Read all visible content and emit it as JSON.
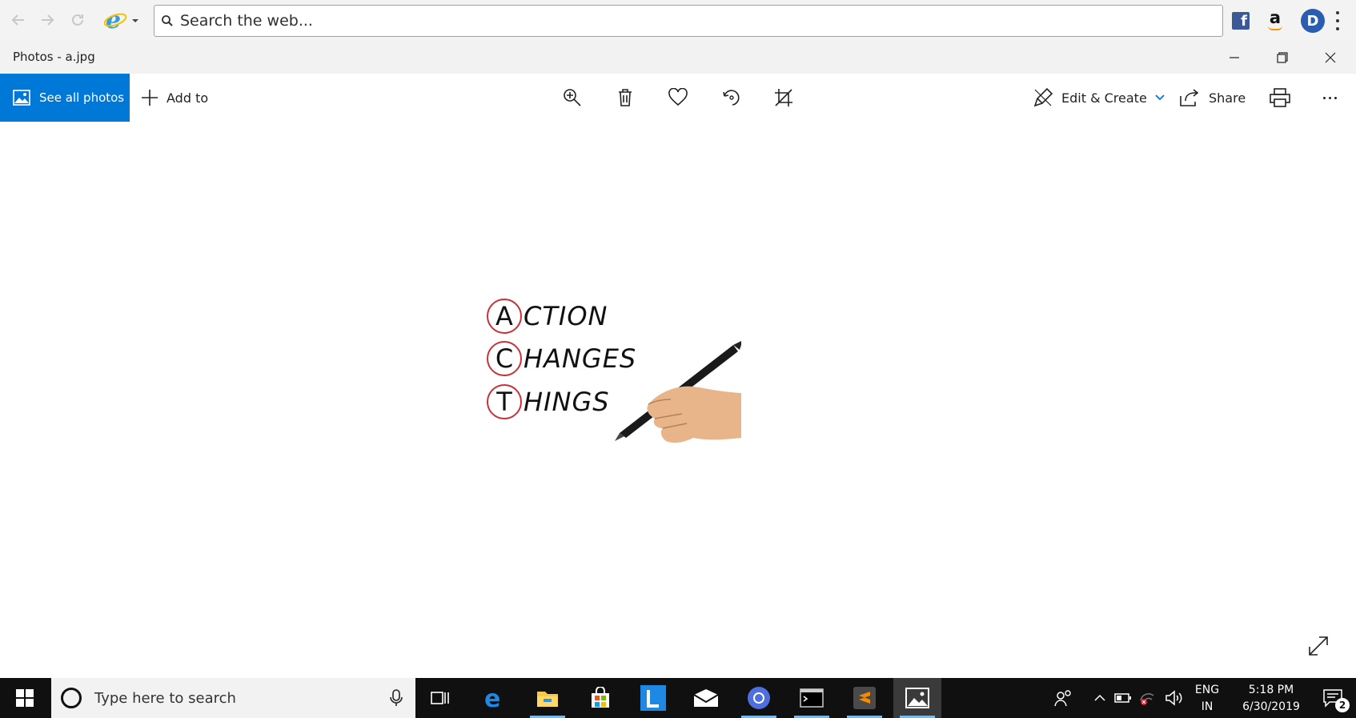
{
  "browser": {
    "search_placeholder": "Search the web...",
    "extensions": [
      "facebook-icon",
      "amazon-icon",
      "d-profile-icon"
    ],
    "ext_letters": {
      "facebook": "f",
      "amazon": "a",
      "profile": "D"
    }
  },
  "window": {
    "title": "Photos - a.jpg"
  },
  "toolbar": {
    "see_all_label": "See all photos",
    "add_to_label": "Add to",
    "edit_create_label": "Edit & Create",
    "share_label": "Share",
    "tools": [
      "zoom-icon",
      "delete-icon",
      "favorite-icon",
      "rotate-icon",
      "crop-icon"
    ]
  },
  "photo": {
    "lines": [
      {
        "initial": "A",
        "rest": "CTION"
      },
      {
        "initial": "C",
        "rest": "HANGES"
      },
      {
        "initial": "T",
        "rest": "HINGS"
      }
    ]
  },
  "taskbar": {
    "search_placeholder": "Type here to search",
    "lang_top": "ENG",
    "lang_bottom": "IN",
    "time": "5:18 PM",
    "date": "6/30/2019",
    "notification_count": "2"
  },
  "colors": {
    "accent": "#0078d7",
    "circle_red": "#c7323a",
    "taskbar": "#101010"
  }
}
